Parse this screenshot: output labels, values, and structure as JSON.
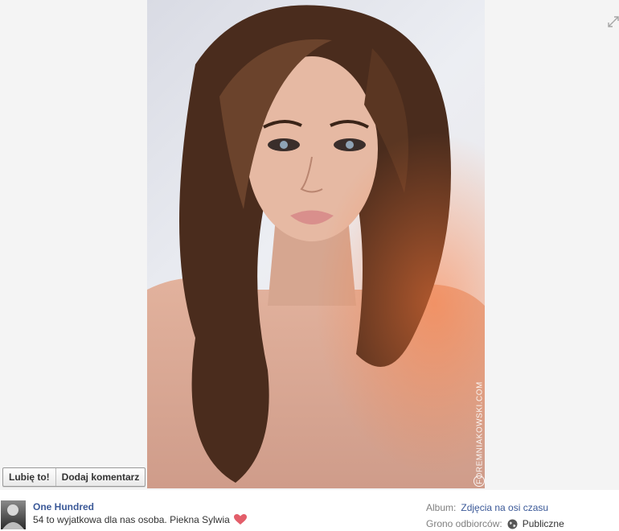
{
  "photo": {
    "watermark": "FOREMNIAKOWSKI.COM"
  },
  "actions": {
    "like_label": "Lubię to!",
    "comment_label": "Dodaj komentarz"
  },
  "post": {
    "author": "One Hundred",
    "caption": "54 to wyjatkowa dla nas osoba. Piekna Sylwia"
  },
  "meta": {
    "album_label": "Album:",
    "album_value": "Zdjęcia na osi czasu",
    "audience_label": "Grono odbiorców:",
    "audience_value": "Publiczne"
  },
  "icons": {
    "expand": "expand-icon",
    "heart": "heart-icon",
    "globe": "globe-icon"
  },
  "colors": {
    "link": "#3b5998",
    "heart": "#e35e6a"
  }
}
